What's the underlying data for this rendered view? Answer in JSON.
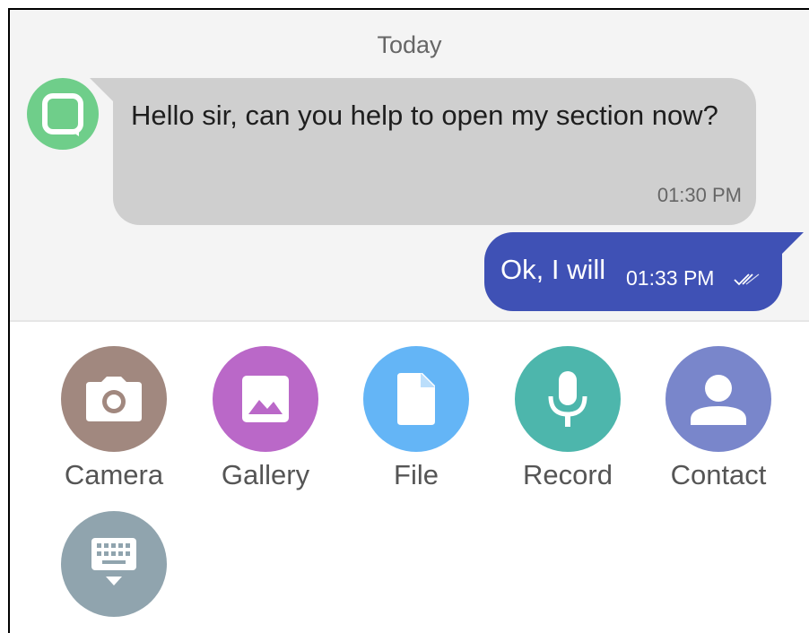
{
  "chat": {
    "date_label": "Today",
    "incoming": {
      "text": "Hello sir, can you help to open my section now?",
      "time": "01:30 PM"
    },
    "outgoing": {
      "text": "Ok, I will",
      "time": "01:33 PM",
      "status_icon": "double-check-icon"
    },
    "avatar_icon": "chat-bubble-icon"
  },
  "attachments": [
    {
      "label": "Camera",
      "icon": "camera-icon",
      "color": "#a1887f"
    },
    {
      "label": "Gallery",
      "icon": "image-icon",
      "color": "#ba68c8"
    },
    {
      "label": "File",
      "icon": "file-icon",
      "color": "#64b5f6"
    },
    {
      "label": "Record",
      "icon": "microphone-icon",
      "color": "#4db6ac"
    },
    {
      "label": "Contact",
      "icon": "person-icon",
      "color": "#7986cb"
    },
    {
      "label": "",
      "icon": "keyboard-hide-icon",
      "color": "#90a4ae"
    }
  ],
  "colors": {
    "chat_background": "#f4f4f4",
    "incoming_bubble": "#cfcfcf",
    "outgoing_bubble": "#3f51b5",
    "avatar": "#6fce8a"
  }
}
